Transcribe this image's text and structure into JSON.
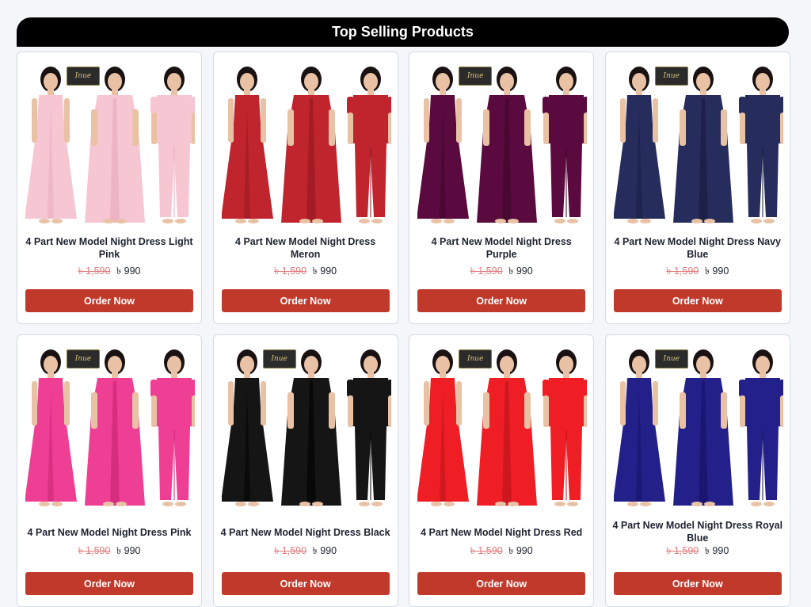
{
  "section": {
    "title": "Top Selling Products"
  },
  "logo_text": "Inue",
  "products": [
    {
      "name": "4 Part New Model Night Dress Light Pink",
      "old_price": "৳ 1,590",
      "price": "৳ 990",
      "button": "Order Now",
      "color": "#f6c6d2",
      "dark": "#e8a9b9",
      "has_logo": true
    },
    {
      "name": "4 Part New Model Night Dress Meron",
      "old_price": "৳ 1,590",
      "price": "৳ 990",
      "button": "Order Now",
      "color": "#c0242d",
      "dark": "#8f1820",
      "has_logo": false
    },
    {
      "name": "4 Part New Model Night Dress Purple",
      "old_price": "৳ 1,590",
      "price": "৳ 990",
      "button": "Order Now",
      "color": "#5a0a3e",
      "dark": "#3d062a",
      "has_logo": true
    },
    {
      "name": "4 Part New Model Night Dress Navy Blue",
      "old_price": "৳ 1,590",
      "price": "৳ 990",
      "button": "Order Now",
      "color": "#262c5c",
      "dark": "#171b3e",
      "has_logo": true
    },
    {
      "name": "4 Part New Model Night Dress Pink",
      "old_price": "৳ 1,590",
      "price": "৳ 990",
      "button": "Order Now",
      "color": "#ef3f95",
      "dark": "#c7226f",
      "has_logo": true
    },
    {
      "name": "4 Part New Model Night Dress Black",
      "old_price": "৳ 1,590",
      "price": "৳ 990",
      "button": "Order Now",
      "color": "#151515",
      "dark": "#000000",
      "has_logo": true
    },
    {
      "name": "4 Part New Model Night Dress Red",
      "old_price": "৳ 1,590",
      "price": "৳ 990",
      "button": "Order Now",
      "color": "#ee1e24",
      "dark": "#b5121a",
      "has_logo": true
    },
    {
      "name": "4 Part New Model Night Dress Royal Blue",
      "old_price": "৳ 1,590",
      "price": "৳ 990",
      "button": "Order Now",
      "color": "#23208a",
      "dark": "#141262",
      "has_logo": true
    }
  ]
}
